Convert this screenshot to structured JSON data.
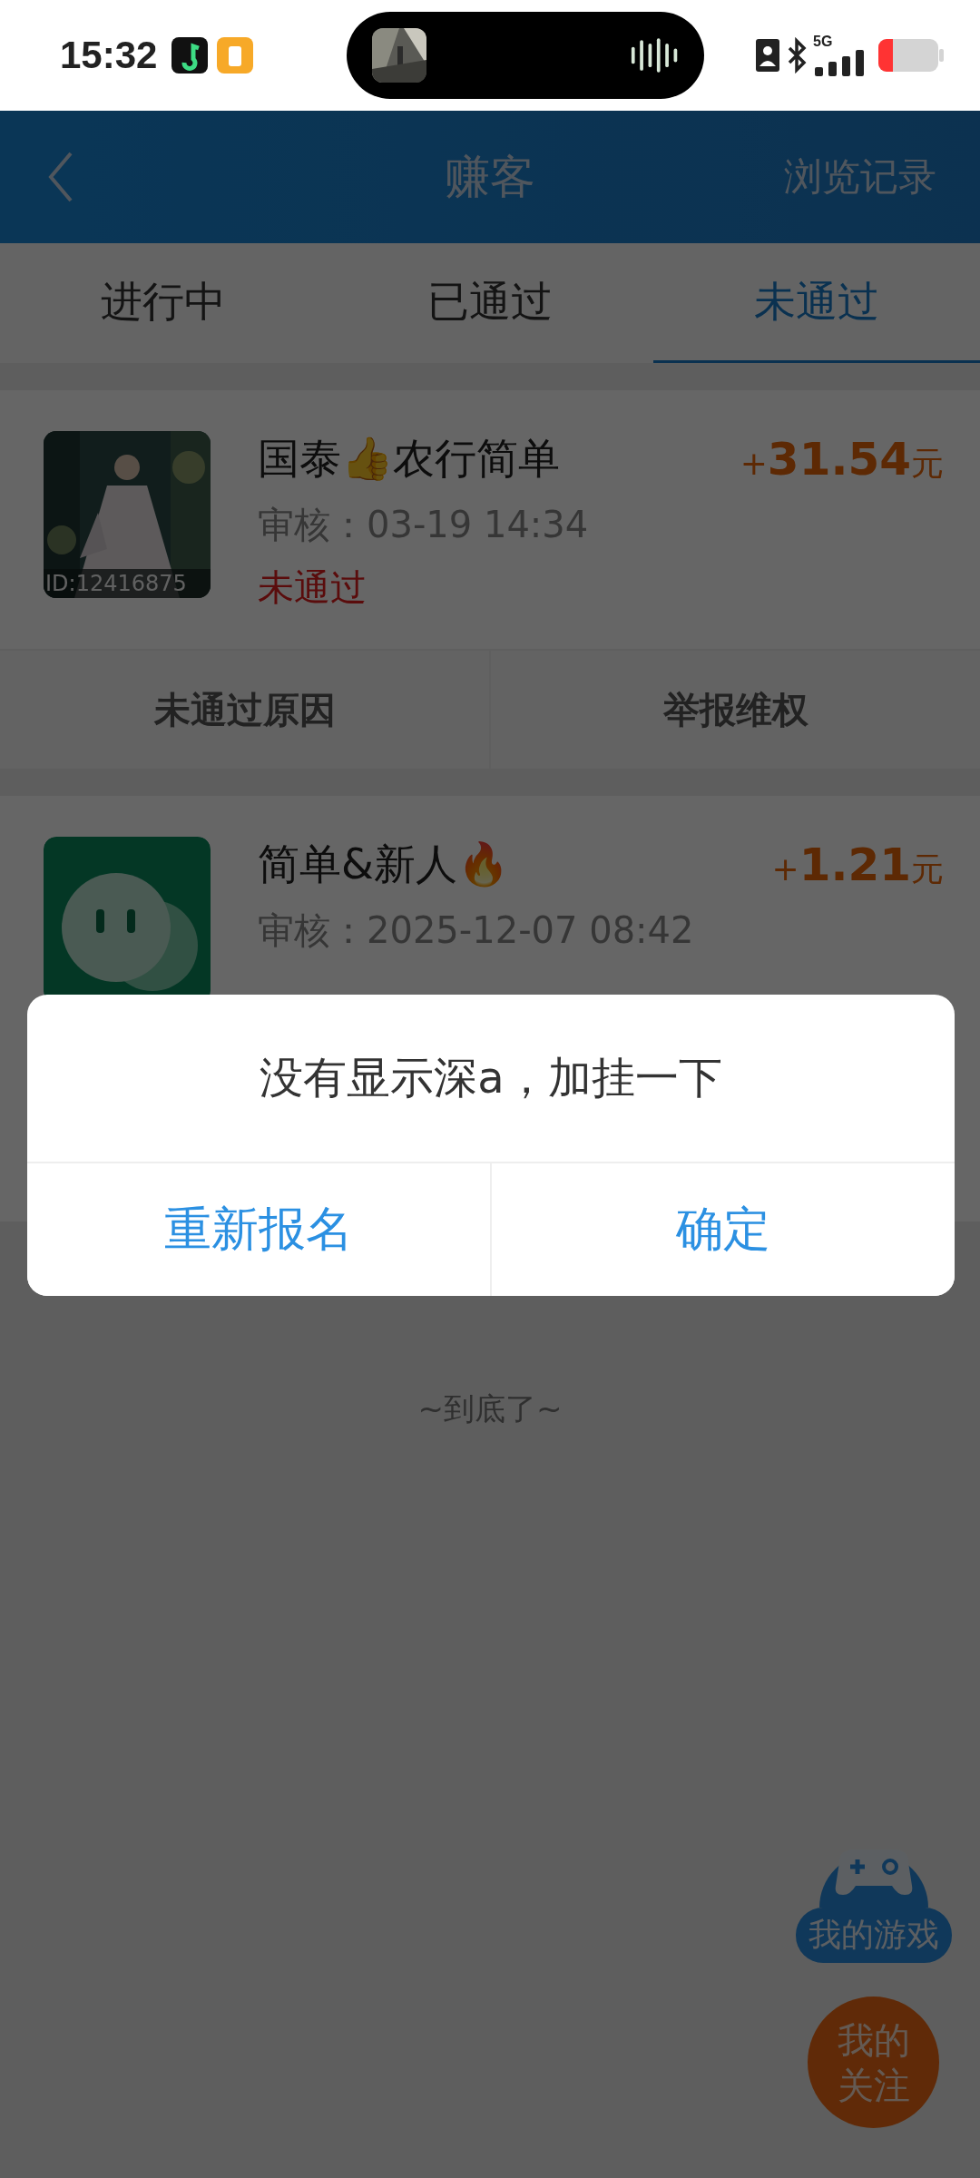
{
  "status_bar": {
    "time": "15:32",
    "network": "5G"
  },
  "header": {
    "title": "赚客",
    "action": "浏览记录"
  },
  "tabs": [
    {
      "label": "进行中",
      "selected": false
    },
    {
      "label": "已通过",
      "selected": false
    },
    {
      "label": "未通过",
      "selected": true
    }
  ],
  "tasks": [
    {
      "title": "国泰👍农行简单",
      "review": "审核：03-19 14:34",
      "reward_sign": "+",
      "reward": "31.54",
      "unit": "元",
      "status": "未通过",
      "thumb": {
        "kind": "picture",
        "id_label": "ID:12416875"
      },
      "actions": [
        "未通过原因",
        "举报维权"
      ]
    },
    {
      "title": "简单&新人🔥",
      "review": "审核：2025-12-07 08:42",
      "reward_sign": "+",
      "reward": "1.21",
      "unit": "元",
      "thumb": {
        "kind": "app-icon"
      }
    }
  ],
  "footer": "~到底了~",
  "dialog": {
    "message": "没有显示深a，加挂一下",
    "buttons": [
      "重新报名",
      "确定"
    ]
  },
  "floating": {
    "games": "我的游戏",
    "follow": "我的关注"
  }
}
